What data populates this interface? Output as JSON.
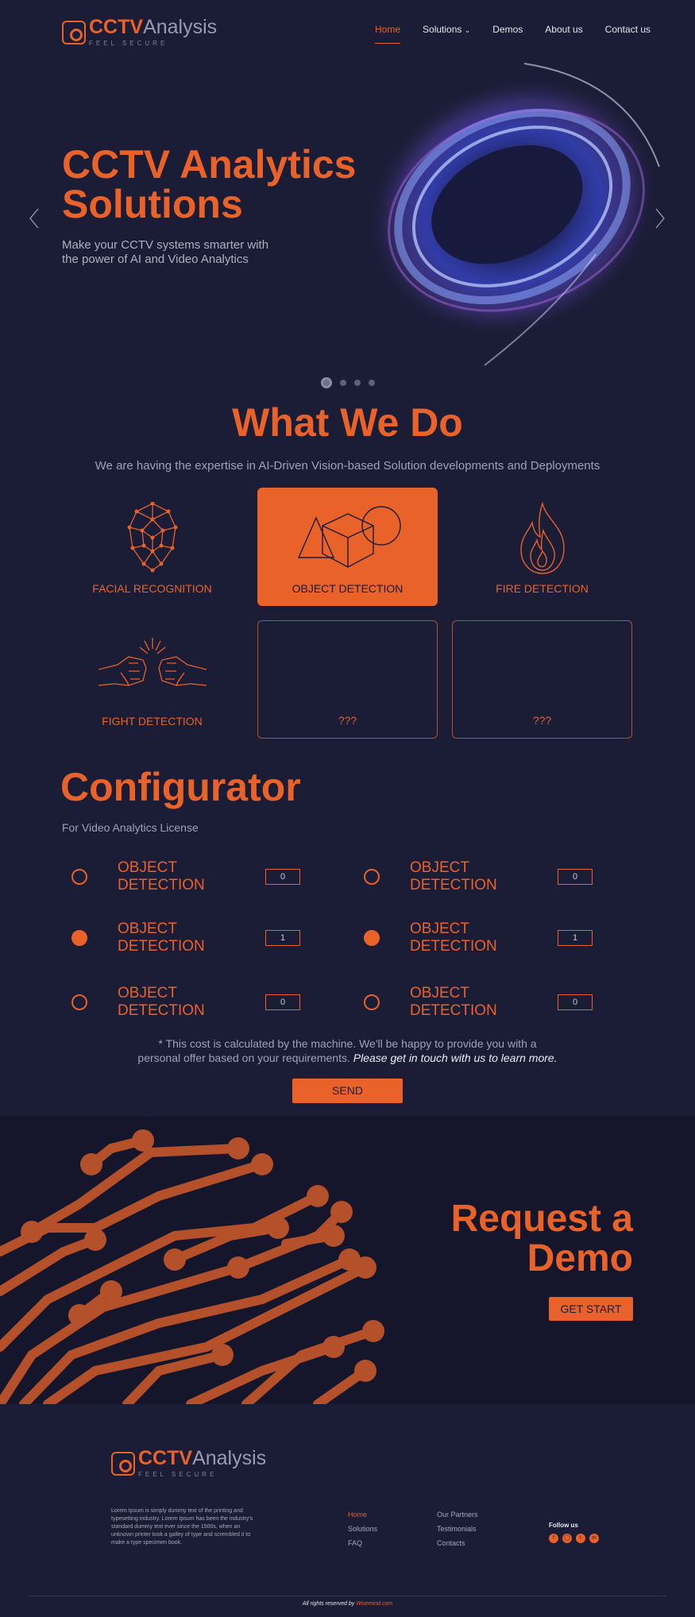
{
  "brand": {
    "name_bold": "CCTV",
    "name_light": "Analysis",
    "tagline": "FEEL SECURE"
  },
  "nav": {
    "items": [
      "Home",
      "Solutions",
      "Demos",
      "About us",
      "Contact us"
    ],
    "active": "Home"
  },
  "hero": {
    "title_line1": "CCTV Analytics",
    "title_line2": "Solutions",
    "subtitle": "Make your CCTV systems smarter with the power of AI and Video Analytics",
    "slide_count": 4,
    "active_slide": 1
  },
  "what_we_do": {
    "title": "What We Do",
    "subtitle": "We are having the expertise in AI-Driven Vision-based Solution developments and Deployments",
    "cards": [
      {
        "label": "FACIAL RECOGNITION",
        "icon": "face-mesh-icon"
      },
      {
        "label": "OBJECT DETECTION",
        "icon": "shapes-cube-icon",
        "active": true
      },
      {
        "label": "FIRE DETECTION",
        "icon": "flame-icon"
      },
      {
        "label": "FIGHT DETECTION",
        "icon": "fists-icon"
      },
      {
        "label": "???",
        "icon": ""
      },
      {
        "label": "???",
        "icon": ""
      }
    ]
  },
  "configurator": {
    "title": "Configurator",
    "subtitle": "For Video Analytics  License",
    "options": [
      {
        "label": "OBJECT DETECTION",
        "qty": "0",
        "selected": false
      },
      {
        "label": "OBJECT DETECTION",
        "qty": "0",
        "selected": false
      },
      {
        "label": "OBJECT DETECTION",
        "qty": "1",
        "selected": true
      },
      {
        "label": "OBJECT DETECTION",
        "qty": "1",
        "selected": true
      },
      {
        "label": "OBJECT DETECTION",
        "qty": "0",
        "selected": false
      },
      {
        "label": "OBJECT DETECTION",
        "qty": "0",
        "selected": false
      }
    ],
    "note_line1": "* This cost is calculated by the machine. We'll be happy to provide you with a",
    "note_line2": "personal offer based on your requirements.",
    "note_emph": "Please get in touch with us to learn more.",
    "send_label": "SEND"
  },
  "demo": {
    "title_line1": "Request a",
    "title_line2": "Demo",
    "button": "GET START"
  },
  "footer": {
    "description": "Lorem Ipsum is simply dummy text of the printing and typesetting industry. Lorem Ipsum has been the industry's standard dummy text ever since the 1500s, when an unknown printer took a galley of type and scrembled it to make a type specimen book.",
    "col1": [
      "Home",
      "Solutions",
      "FAQ"
    ],
    "col2": [
      "Our Partners",
      "Testimonials",
      "Contacts"
    ],
    "follow": "Follow us",
    "socials": [
      "facebook-icon",
      "instagram-icon",
      "twitter-icon",
      "linkedin-icon"
    ],
    "copyright": "All rights reserved by",
    "copyright_link": "Wisemind.com"
  },
  "colors": {
    "accent": "#e8622a",
    "background": "#1b1c36"
  }
}
